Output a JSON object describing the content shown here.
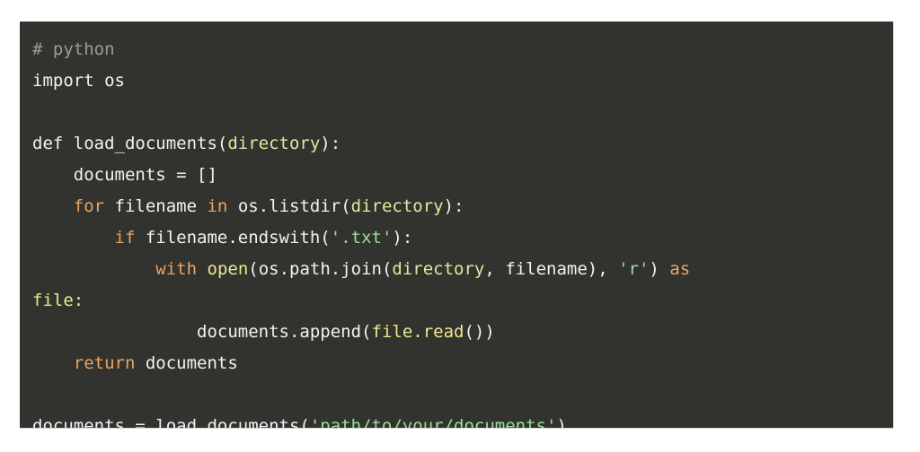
{
  "document": {
    "type": "code-snippet",
    "language": "python",
    "background_color": "#32322f",
    "page_background_color": "#ffffff",
    "colors": {
      "plain": "#f2f2f2",
      "comment": "#9a9a9a",
      "keyword": "#e8a561",
      "builtin": "#ece98c",
      "parameter": "#e6e6a0",
      "string": "#99e09b"
    },
    "code": {
      "full_text": "# python\nimport os\n\ndef load_documents(directory):\n    documents = []\n    for filename in os.listdir(directory):\n        if filename.endswith('.txt'):\n            with open(os.path.join(directory, filename), 'r') as file:\n                documents.append(file.read())\n    return documents\n\ndocuments = load_documents('path/to/your/documents')",
      "lines": [
        {
          "id": "line-1",
          "tokens": [
            {
              "text": "# python",
              "type": "comment"
            }
          ]
        },
        {
          "id": "line-2",
          "tokens": [
            {
              "text": "import os",
              "type": "plain"
            }
          ]
        },
        {
          "id": "line-3",
          "tokens": [
            {
              "text": "",
              "type": "plain"
            }
          ]
        },
        {
          "id": "line-4",
          "tokens": [
            {
              "text": "def load_documents(",
              "type": "plain"
            },
            {
              "text": "directory",
              "type": "param"
            },
            {
              "text": "):",
              "type": "plain"
            }
          ]
        },
        {
          "id": "line-5",
          "tokens": [
            {
              "text": "    documents = []",
              "type": "plain"
            }
          ]
        },
        {
          "id": "line-6",
          "tokens": [
            {
              "text": "    ",
              "type": "plain"
            },
            {
              "text": "for",
              "type": "keyword"
            },
            {
              "text": " filename ",
              "type": "plain"
            },
            {
              "text": "in",
              "type": "keyword"
            },
            {
              "text": " os.listdir(",
              "type": "plain"
            },
            {
              "text": "directory",
              "type": "param"
            },
            {
              "text": "):",
              "type": "plain"
            }
          ]
        },
        {
          "id": "line-7",
          "tokens": [
            {
              "text": "        ",
              "type": "plain"
            },
            {
              "text": "if",
              "type": "keyword"
            },
            {
              "text": " filename.endswith(",
              "type": "plain"
            },
            {
              "text": "'.txt'",
              "type": "string"
            },
            {
              "text": "):",
              "type": "plain"
            }
          ]
        },
        {
          "id": "line-8",
          "tokens": [
            {
              "text": "            ",
              "type": "plain"
            },
            {
              "text": "with",
              "type": "keyword"
            },
            {
              "text": " ",
              "type": "plain"
            },
            {
              "text": "open",
              "type": "builtin"
            },
            {
              "text": "(os.path.join(",
              "type": "plain"
            },
            {
              "text": "directory",
              "type": "param"
            },
            {
              "text": ", filename), ",
              "type": "plain"
            },
            {
              "text": "'r'",
              "type": "string"
            },
            {
              "text": ") ",
              "type": "plain"
            },
            {
              "text": "as",
              "type": "keyword"
            }
          ]
        },
        {
          "id": "line-9",
          "wrapped_continuation": true,
          "tokens": [
            {
              "text": "file:",
              "type": "builtin"
            }
          ]
        },
        {
          "id": "line-10",
          "tokens": [
            {
              "text": "                documents.append(",
              "type": "plain"
            },
            {
              "text": "file.read",
              "type": "builtin"
            },
            {
              "text": "())",
              "type": "plain"
            }
          ]
        },
        {
          "id": "line-11",
          "tokens": [
            {
              "text": "    ",
              "type": "plain"
            },
            {
              "text": "return",
              "type": "keyword"
            },
            {
              "text": " documents",
              "type": "plain"
            }
          ]
        },
        {
          "id": "line-12",
          "tokens": [
            {
              "text": "",
              "type": "plain"
            }
          ]
        },
        {
          "id": "line-13",
          "tokens": [
            {
              "text": "documents = load_documents(",
              "type": "plain"
            },
            {
              "text": "'path/to/your/documents'",
              "type": "string"
            },
            {
              "text": ")",
              "type": "plain"
            }
          ]
        }
      ]
    }
  }
}
